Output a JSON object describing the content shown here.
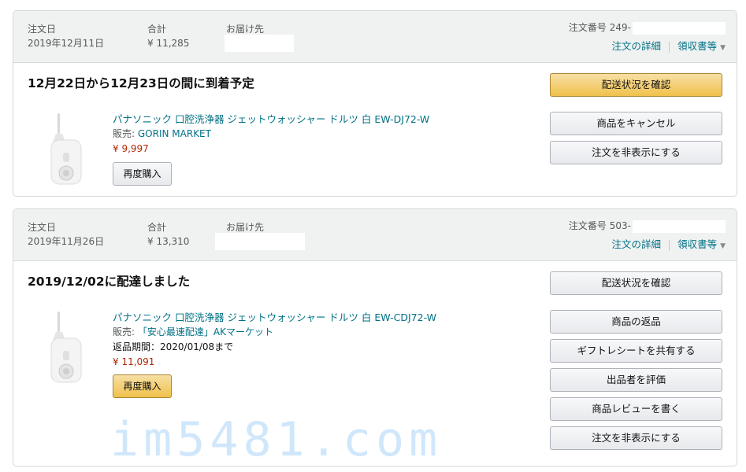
{
  "orders": [
    {
      "date_label": "注文日",
      "date": "2019年12月11日",
      "total_label": "合計",
      "total": "¥ 11,285",
      "ship_to_label": "お届け先",
      "order_number_label": "注文番号",
      "order_number": "249-",
      "details_link": "注文の詳細",
      "receipt_link": "領収書等",
      "status": "12月22日から12月23日の間に到着予定",
      "product_title": "パナソニック 口腔洗浄器 ジェットウォッシャー ドルツ 白 EW-DJ72-W",
      "seller_label": "販売:",
      "seller_name": "GORIN MARKET",
      "price": "¥ 9,997",
      "buy_again": "再度購入",
      "buttons": [
        "配送状況を確認",
        "商品をキャンセル",
        "注文を非表示にする"
      ]
    },
    {
      "date_label": "注文日",
      "date": "2019年11月26日",
      "total_label": "合計",
      "total": "¥ 13,310",
      "ship_to_label": "お届け先",
      "order_number_label": "注文番号",
      "order_number": "503-",
      "details_link": "注文の詳細",
      "receipt_link": "領収書等",
      "status": "2019/12/02に配達しました",
      "product_title": "パナソニック 口腔洗浄器 ジェットウォッシャー ドルツ 白 EW-CDJ72-W",
      "seller_label": "販売:",
      "seller_name": "「安心最速配達」AKマーケット",
      "return_period": "返品期間：2020/01/08まで",
      "price": "¥ 11,091",
      "buy_again": "再度購入",
      "buttons": [
        "配送状況を確認",
        "商品の返品",
        "ギフトレシートを共有する",
        "出品者を評価",
        "商品レビューを書く",
        "注文を非表示にする"
      ]
    }
  ],
  "watermark": "im5481.com",
  "colors": {
    "link": "#007185",
    "price": "#b12704",
    "primary_button": "#f0c14b",
    "header_bg": "#f0f2f2",
    "watermark": "#c8e3fb"
  },
  "icons": {
    "receipt_caret": "chevron-down-icon"
  }
}
